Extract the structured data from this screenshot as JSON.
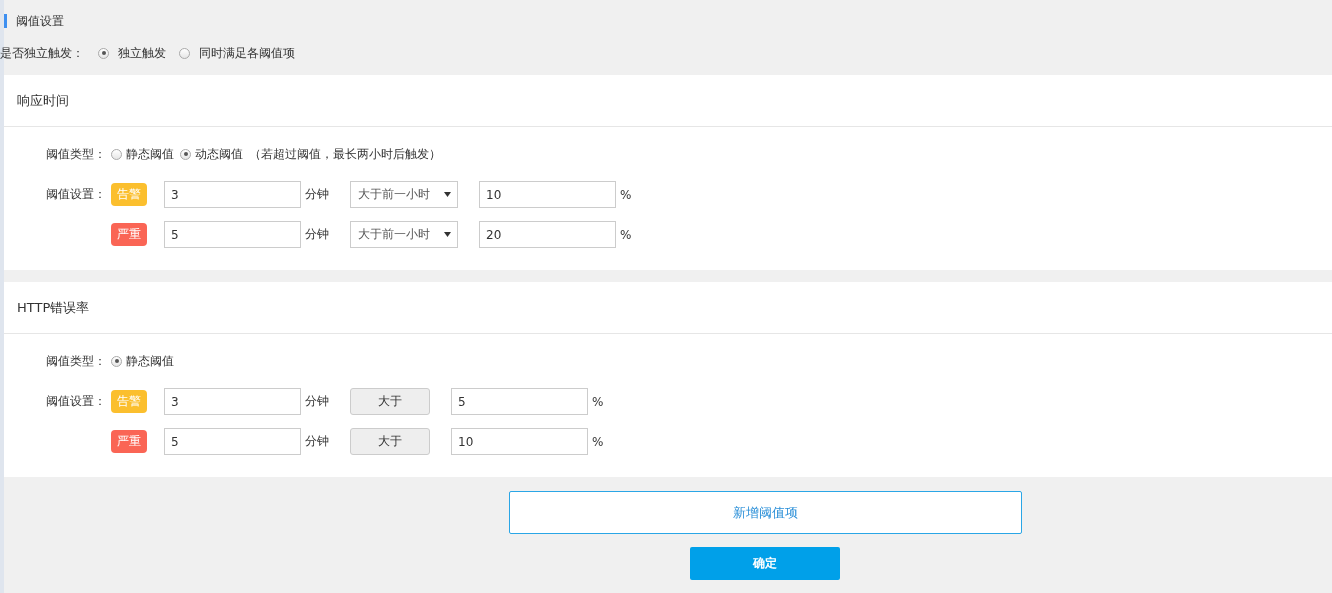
{
  "page_title": "阈值设置",
  "trigger_mode": {
    "label": "是否独立触发：",
    "options": [
      {
        "label": "独立触发",
        "selected": true
      },
      {
        "label": "同时满足各阈值项",
        "selected": false
      }
    ]
  },
  "sections": [
    {
      "title": "响应时间",
      "type_label": "阈值类型：",
      "type_options": [
        {
          "label": "静态阈值",
          "selected": false
        },
        {
          "label": "动态阈值",
          "selected": true,
          "note": "（若超过阈值，最长两小时后触发）"
        }
      ],
      "setting_label": "阈值设置：",
      "rows": [
        {
          "level": {
            "text": "告警",
            "color": "#fbbf2e"
          },
          "minutes": "3",
          "unit": "分钟",
          "comparator": {
            "kind": "select",
            "text": "大于前一小时"
          },
          "value": "10",
          "percent": "%"
        },
        {
          "level": {
            "text": "严重",
            "color": "#fa6555"
          },
          "minutes": "5",
          "unit": "分钟",
          "comparator": {
            "kind": "select",
            "text": "大于前一小时"
          },
          "value": "20",
          "percent": "%"
        }
      ]
    },
    {
      "title": "HTTP错误率",
      "type_label": "阈值类型：",
      "type_options": [
        {
          "label": "静态阈值",
          "selected": true
        }
      ],
      "setting_label": "阈值设置：",
      "rows": [
        {
          "level": {
            "text": "告警",
            "color": "#fbbf2e"
          },
          "minutes": "3",
          "unit": "分钟",
          "comparator": {
            "kind": "fixed",
            "text": "大于"
          },
          "value": "5",
          "percent": "%"
        },
        {
          "level": {
            "text": "严重",
            "color": "#fa6555"
          },
          "minutes": "5",
          "unit": "分钟",
          "comparator": {
            "kind": "fixed",
            "text": "大于"
          },
          "value": "10",
          "percent": "%"
        }
      ]
    }
  ],
  "add_button": "新增阈值项",
  "confirm_button": "确定"
}
